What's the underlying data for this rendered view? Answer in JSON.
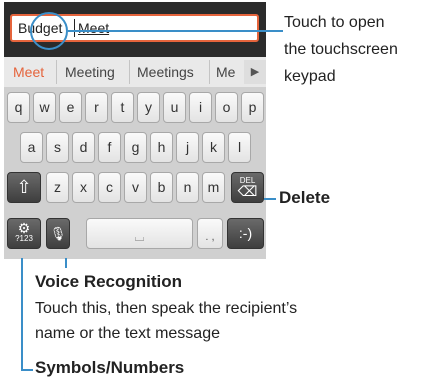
{
  "text_field": {
    "word1": "Budget",
    "word2": "Meet"
  },
  "suggestions": [
    "Meet",
    "Meeting",
    "Meetings",
    "Me"
  ],
  "suggest_arrow": "▶",
  "rows": {
    "row1": [
      "q",
      "w",
      "e",
      "r",
      "t",
      "y",
      "u",
      "i",
      "o",
      "p"
    ],
    "row2": [
      "a",
      "s",
      "d",
      "f",
      "g",
      "h",
      "j",
      "k",
      "l"
    ],
    "row3": [
      "z",
      "x",
      "c",
      "v",
      "b",
      "n",
      "m"
    ]
  },
  "keys": {
    "shift": "⇧",
    "delete_small": "DEL",
    "delete_glyph": "⌫",
    "symbols_small": "?123",
    "symbols_icon": "⚙",
    "mic": "🎙",
    "space": "⌴",
    "punct": ". ,",
    "emoticon": ":-)"
  },
  "callouts": {
    "keypad_line1": "Touch to open",
    "keypad_line2": "the touchscreen",
    "keypad_line3": "keypad",
    "delete": "Delete",
    "voice_title": "Voice Recognition",
    "voice_desc1": "Touch this, then speak the recipient’s",
    "voice_desc2": "name or the text message",
    "symbols": "Symbols/Numbers"
  },
  "colors": {
    "accent": "#e5643c",
    "callout": "#3a8ec8"
  }
}
